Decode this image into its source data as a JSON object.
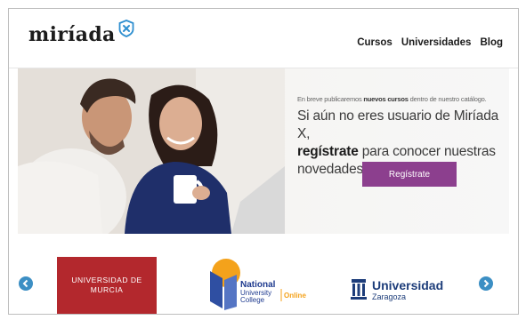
{
  "header": {
    "logo_text": "miríada",
    "nav": [
      "Cursos",
      "Universidades",
      "Blog"
    ]
  },
  "hero": {
    "small_pre": "En breve publicaremos ",
    "small_bold": "nuevos cursos",
    "small_post": " dentro de nuestro catálogo.",
    "line1": "Si aún no eres usuario de Miríada X,",
    "line2_bold": "regístrate",
    "line2_rest": " para conocer nuestras",
    "line3": "novedades.",
    "cta_label": "Regístrate"
  },
  "partners": {
    "murcia_line1": "UNIVERSIDAD DE",
    "murcia_line2": "MURCIA",
    "nuc_line1": "National",
    "nuc_line2": "University",
    "nuc_line3": "College",
    "nuc_online": "Online",
    "zar_title": "Universidad",
    "zar_sub": "Zaragoza"
  },
  "colors": {
    "brand_purple": "#8c3f8e",
    "arrow_blue": "#3c8fc4",
    "murcia_red": "#b3282d"
  }
}
